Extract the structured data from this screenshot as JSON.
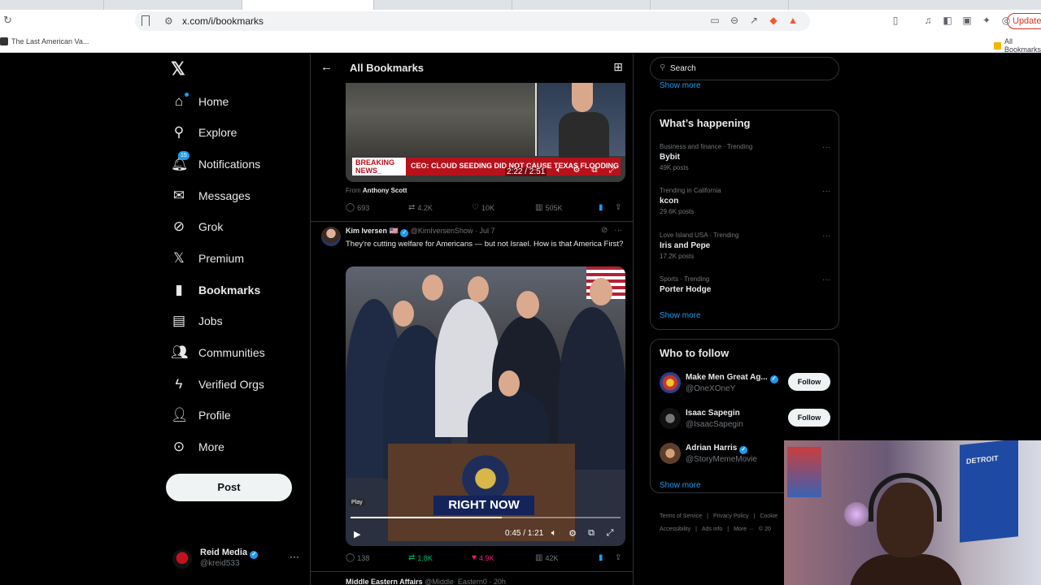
{
  "browser": {
    "url": "x.com/i/bookmarks",
    "bookmark_bar_item": "The Last American Va...",
    "all_bookmarks": "All Bookmarks",
    "update_label": "Update"
  },
  "sidebar": {
    "nav": [
      {
        "label": "Home",
        "icon": "home-icon"
      },
      {
        "label": "Explore",
        "icon": "search-icon"
      },
      {
        "label": "Notifications",
        "icon": "bell-icon"
      },
      {
        "label": "Messages",
        "icon": "envelope-icon"
      },
      {
        "label": "Grok",
        "icon": "grok-icon"
      },
      {
        "label": "Premium",
        "icon": "x-icon"
      },
      {
        "label": "Bookmarks",
        "icon": "bookmark-icon"
      },
      {
        "label": "Jobs",
        "icon": "briefcase-icon"
      },
      {
        "label": "Communities",
        "icon": "people-icon"
      },
      {
        "label": "Verified Orgs",
        "icon": "lightning-icon"
      },
      {
        "label": "Profile",
        "icon": "person-icon"
      },
      {
        "label": "More",
        "icon": "more-circle-icon"
      }
    ],
    "notif_count": "15",
    "post_label": "Post",
    "account": {
      "name": "Reid Media",
      "handle": "@kreid533"
    }
  },
  "main": {
    "title": "All Bookmarks",
    "tweet1": {
      "breaking": "BREAKING NEWS_",
      "ticker": "CEO: CLOUD SEEDING DID NOT CAUSE TEXAS FLOODING",
      "time": "2:22 / 2:51",
      "from_prefix": "From",
      "from_name": "Anthony Scott",
      "replies": "693",
      "reposts": "4.2K",
      "likes": "10K",
      "views": "505K"
    },
    "tweet2": {
      "name": "Kim Iversen",
      "flag": "🇺🇸",
      "handle": "@KimIversenShow",
      "date": "Jul 7",
      "text": "They're cutting welfare for Americans — but not Israel. How is that America First?",
      "banner": "RIGHT NOW",
      "play_tag": "Play",
      "time": "0:45 / 1:21",
      "progress": 0.56,
      "replies": "138",
      "reposts": "1.8K",
      "likes": "4.9K",
      "views": "42K"
    },
    "next_peek": {
      "name": "Middle Eastern Affairs",
      "handle": "@Middle_Eastern0",
      "date": "20h"
    }
  },
  "right": {
    "search_placeholder": "Search",
    "show_more": "Show more",
    "happening_title": "What’s happening",
    "trends": [
      {
        "context": "Business and finance · Trending",
        "name": "Bybit",
        "count": "49K posts"
      },
      {
        "context": "Trending in California",
        "name": "kcon",
        "count": "29.6K posts"
      },
      {
        "context": "Love Island USA · Trending",
        "name": "Iris and Pepe",
        "count": "17.2K posts"
      },
      {
        "context": "Sports · Trending",
        "name": "Porter Hodge",
        "count": ""
      }
    ],
    "wtf_title": "Who to follow",
    "follow_label": "Follow",
    "who_to_follow": [
      {
        "name": "Make Men Great Ag...",
        "handle": "@OneXOneY"
      },
      {
        "name": "Isaac Sapegin",
        "handle": "@IsaacSapegin"
      },
      {
        "name": "Adrian Harris",
        "handle": "@StoryMemeMovie"
      }
    ],
    "footer": [
      "Terms of Service",
      "|",
      "Privacy Policy",
      "|",
      "Cookie",
      "Accessibility",
      "|",
      "Ads info",
      "|",
      "More ···",
      "© 20"
    ]
  },
  "webcam": {
    "poster_text": "DETROIT"
  }
}
